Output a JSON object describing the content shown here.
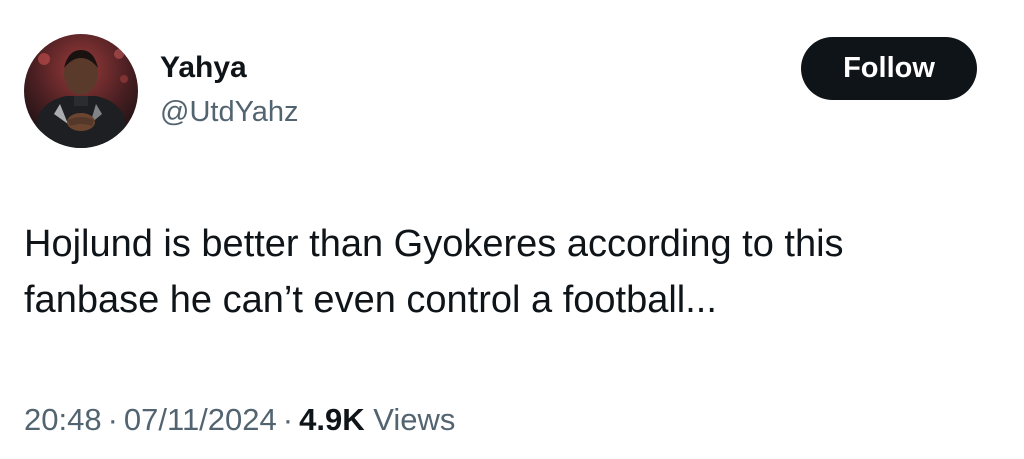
{
  "user": {
    "display_name": "Yahya",
    "handle": "@UtdYahz"
  },
  "follow_button": {
    "label": "Follow"
  },
  "tweet": {
    "text_lines": [
      "Hojlund is better than Gyokeres according to this",
      "fanbase he can’t even control a football..."
    ]
  },
  "meta": {
    "time": "20:48",
    "separator": "·",
    "date": "07/11/2024",
    "views_count": "4.9K",
    "views_label": "Views"
  },
  "colors": {
    "text_primary": "#0f1419",
    "text_secondary": "#536471",
    "button_bg": "#0f1419",
    "button_text": "#ffffff"
  },
  "icons": {
    "avatar": "profile-photo-avatar"
  }
}
